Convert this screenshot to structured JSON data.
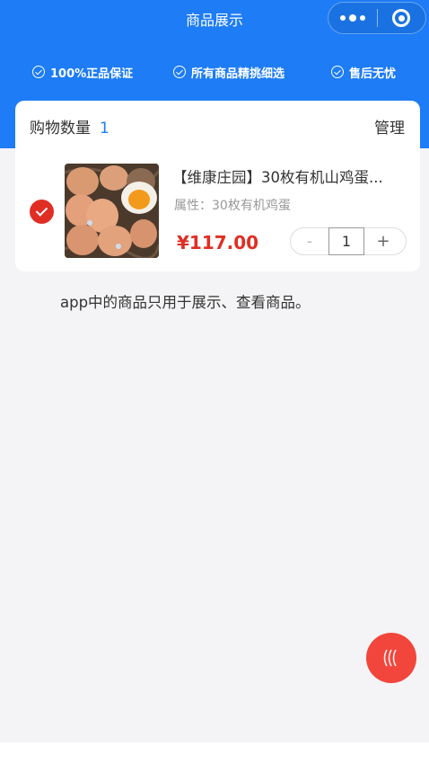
{
  "nav": {
    "title": "商品展示"
  },
  "guarantees": [
    {
      "label": "100%正品保证"
    },
    {
      "label": "所有商品精挑细选"
    },
    {
      "label": "售后无忧"
    }
  ],
  "cart": {
    "title": "购物数量",
    "count": "1",
    "manage_label": "管理"
  },
  "item": {
    "name": "【维康庄园】30枚有机山鸡蛋...",
    "attribute": "属性：30枚有机鸡蛋",
    "price": "¥117.00",
    "minus": "-",
    "quantity": "1",
    "plus": "+",
    "selected": true
  },
  "note": "app中的商品只用于展示、查看商品。",
  "colors": {
    "primary": "#1d7cf6",
    "accent_red": "#e02e24",
    "fab": "#f2463c",
    "background": "#f4f4f6"
  },
  "icons": {
    "guarantee": "check-circle-icon",
    "select": "check-icon",
    "fab": "waves-icon",
    "capsule_menu": "more-dots-icon",
    "capsule_close": "target-circle-icon"
  }
}
